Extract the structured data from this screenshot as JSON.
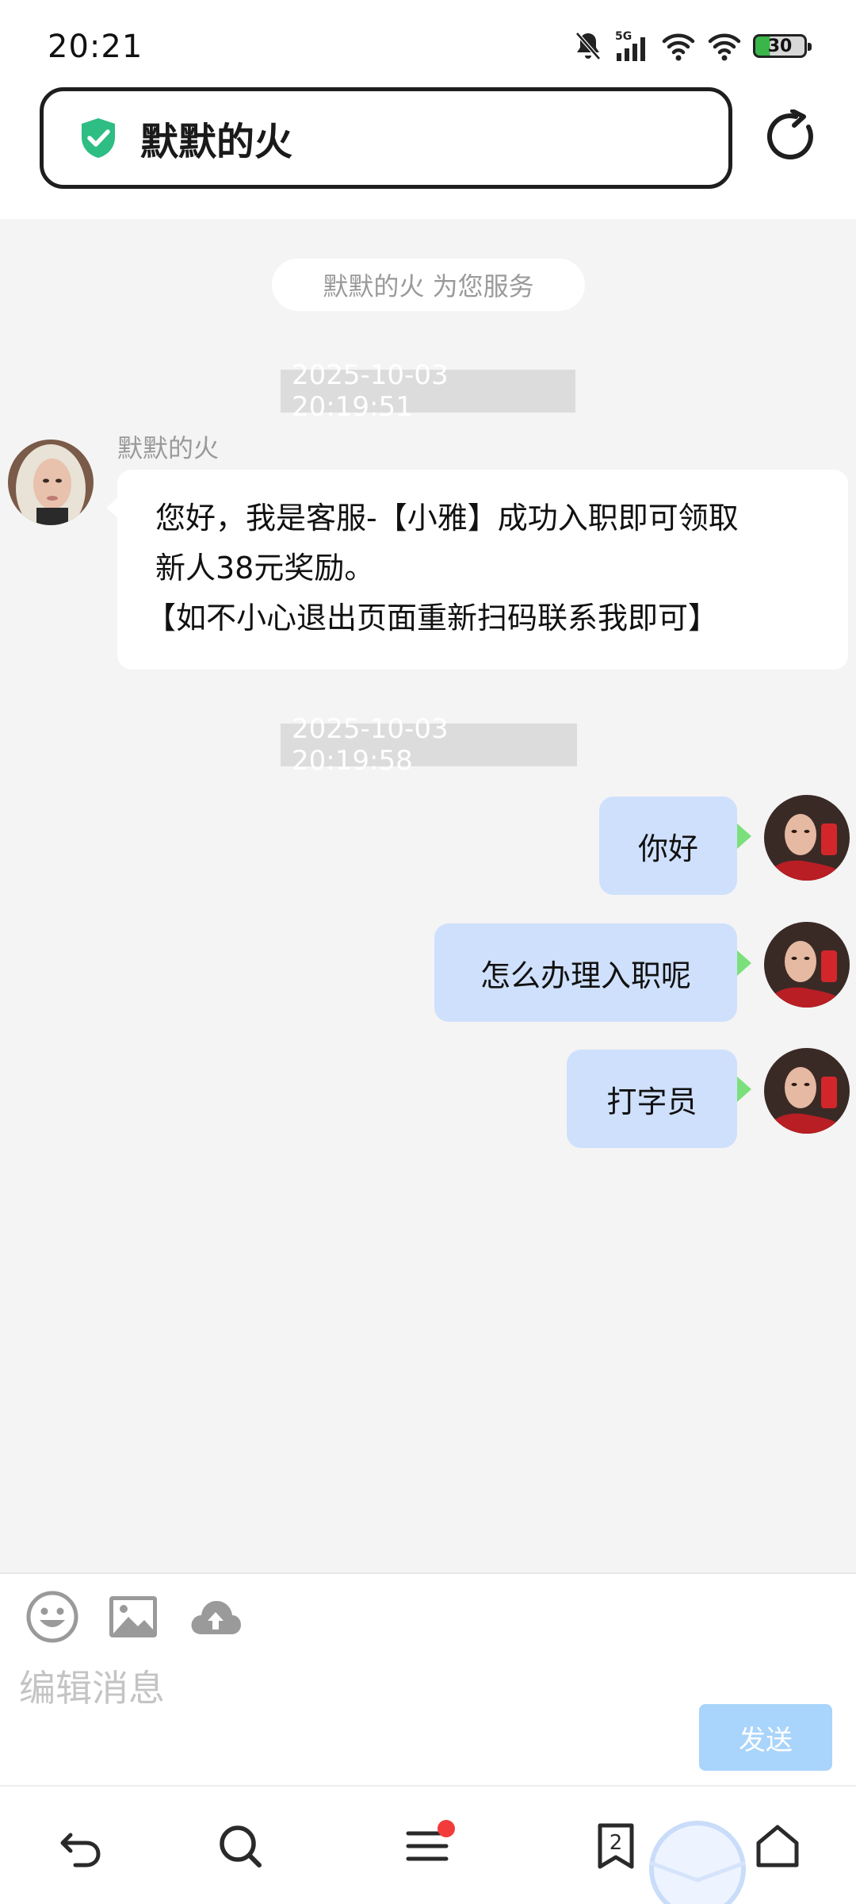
{
  "status_bar": {
    "time": "20:21",
    "network": "5G",
    "battery": "30"
  },
  "header": {
    "title": "默默的火"
  },
  "chat": {
    "service_notice": "默默的火 为您服务",
    "timestamps": [
      "2025-10-03 20:19:51",
      "2025-10-03 20:19:58"
    ],
    "incoming": {
      "sender": "默默的火",
      "lines": [
        "您好，我是客服-【小雅】成功入职即可领取",
        "新人38元奖励。",
        "【如不小心退出页面重新扫码联系我即可】"
      ]
    },
    "outgoing": [
      "你好",
      "怎么办理入职呢",
      "打字员"
    ]
  },
  "composer": {
    "placeholder": "编辑消息",
    "send_label": "发送"
  },
  "bottom_nav": {
    "tabs_badge": "2"
  },
  "colors": {
    "accent": "#a9d4fb",
    "bubble_out": "#cfe0fc",
    "shield": "#2ebd82",
    "notify_dot": "#f33b3b"
  }
}
